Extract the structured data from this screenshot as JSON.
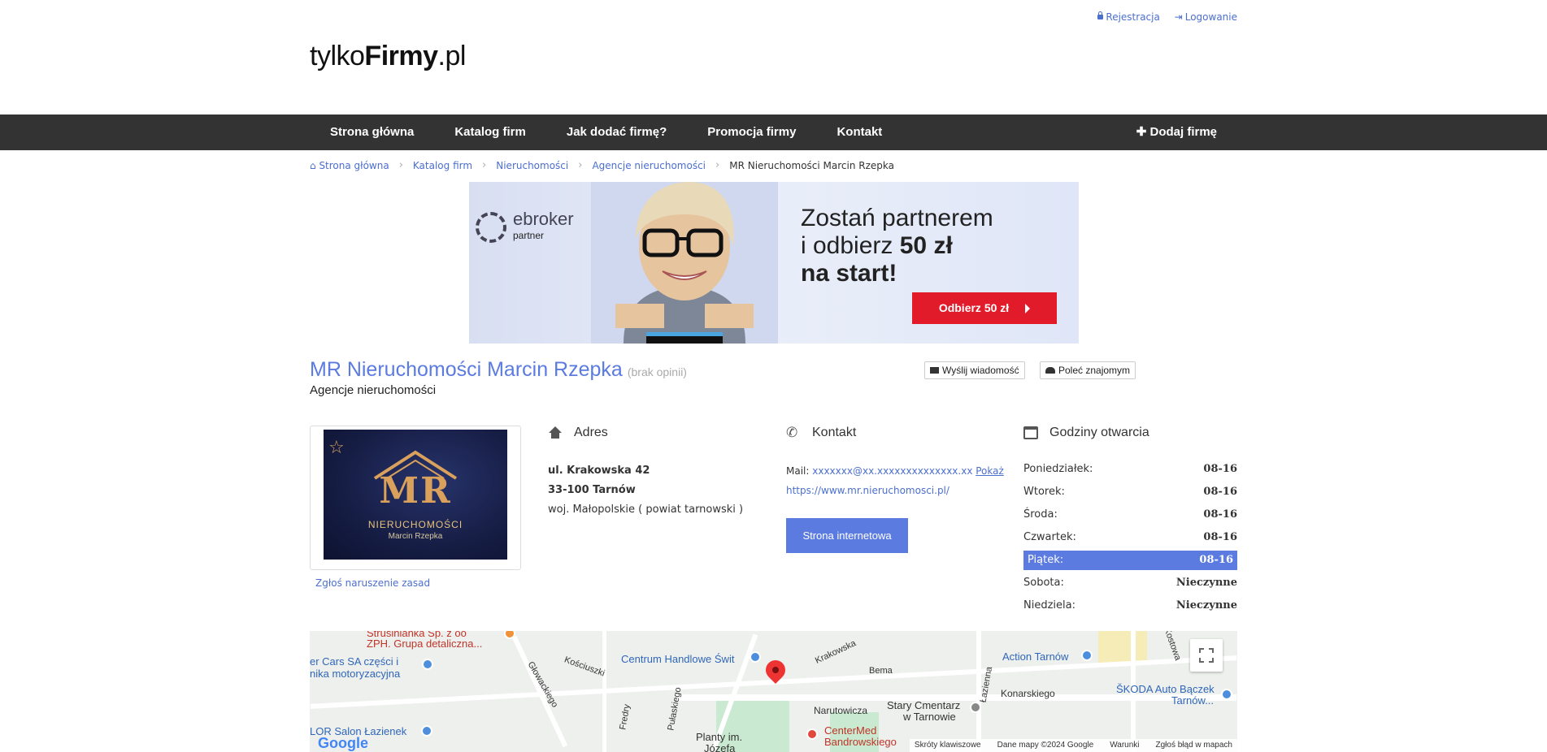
{
  "header": {
    "register_label": "Rejestracja",
    "login_label": "Logowanie",
    "logo_prefix": "tylko",
    "logo_bold": "Firmy",
    "logo_suffix": ".pl"
  },
  "nav": {
    "items": [
      {
        "label": "Strona główna"
      },
      {
        "label": "Katalog firm"
      },
      {
        "label": "Jak dodać firmę?"
      },
      {
        "label": "Promocja firmy"
      },
      {
        "label": "Kontakt"
      }
    ],
    "add_label": "Dodaj firmę"
  },
  "breadcrumb": [
    "Strona główna",
    "Katalog firm",
    "Nieruchomości",
    "Agencje nieruchomości",
    "MR Nieruchomości Marcin Rzepka"
  ],
  "banner": {
    "brand": "ebroker",
    "brand_sub": "partner",
    "line1": "Zostań partnerem",
    "line2_pre": "i odbierz ",
    "line2_bold": "50 zł",
    "line3": "na start!",
    "cta": "Odbierz 50 zł"
  },
  "company": {
    "name": "MR Nieruchomości Marcin Rzepka",
    "opinions": "(brak opinii)",
    "category": "Agencje nieruchomości",
    "send_message": "Wyślij wiadomość",
    "recommend": "Poleć znajomym",
    "logo_text": "MR",
    "logo_line1": "NIERUCHOMOŚCI",
    "logo_line2": "Marcin Rzepka",
    "report": "Zgłoś naruszenie zasad"
  },
  "address": {
    "heading": "Adres",
    "street": "ul. Krakowska 42",
    "city": "33-100 Tarnów",
    "region": "woj. Małopolskie ( powiat tarnowski )"
  },
  "contact": {
    "heading": "Kontakt",
    "mail_label": "Mail:",
    "mail_value": "xxxxxxx@xx.xxxxxxxxxxxxxx.xx",
    "show_label": "Pokaż",
    "website": "https://www.mr.nieruchomosci.pl/",
    "website_button": "Strona internetowa"
  },
  "hours": {
    "heading": "Godziny otwarcia",
    "days": [
      {
        "day": "Poniedziałek:",
        "value": "08-16",
        "today": false
      },
      {
        "day": "Wtorek:",
        "value": "08-16",
        "today": false
      },
      {
        "day": "Środa:",
        "value": "08-16",
        "today": false
      },
      {
        "day": "Czwartek:",
        "value": "08-16",
        "today": false
      },
      {
        "day": "Piątek:",
        "value": "08-16",
        "today": true
      },
      {
        "day": "Sobota:",
        "value": "Nieczynne",
        "today": false
      },
      {
        "day": "Niedziela:",
        "value": "Nieczynne",
        "today": false
      }
    ]
  },
  "map": {
    "labels": {
      "strusinianka": "Strusinianka Sp. z oo",
      "zph": "ZPH. Grupa detaliczna...",
      "cars": "er Cars SA części i",
      "moto": "nika motoryzacyjna",
      "centrum": "Centrum Handlowe Świt",
      "koscius": "Kościuszki",
      "glowac": "Głowackiego",
      "krakowska": "Krakowska",
      "bema": "Bema",
      "narutowicza": "Narutowicza",
      "fredry": "Fredry",
      "pulaskiego": "Pułaskiego",
      "planty": "Planty im.",
      "jozefa": "Józefa",
      "cmentarz": "Stary Cmentarz",
      "wtarnowie": "w Tarnowie",
      "centermed": "CenterMed",
      "bandrow": "Bandrowskiego",
      "lazienna": "Łazienna",
      "konarskiego": "Konarskiego",
      "action": "Action Tarnów",
      "skoda": "ŠKODA Auto Bączek",
      "skoda2": "Tarnów...",
      "lor": "LOR Salon Łazienek",
      "kosto": "Kostowa"
    },
    "footer": [
      "Skróty klawiszowe",
      "Dane mapy ©2024 Google",
      "Warunki",
      "Zgłoś błąd w mapach"
    ],
    "google": "Google"
  }
}
